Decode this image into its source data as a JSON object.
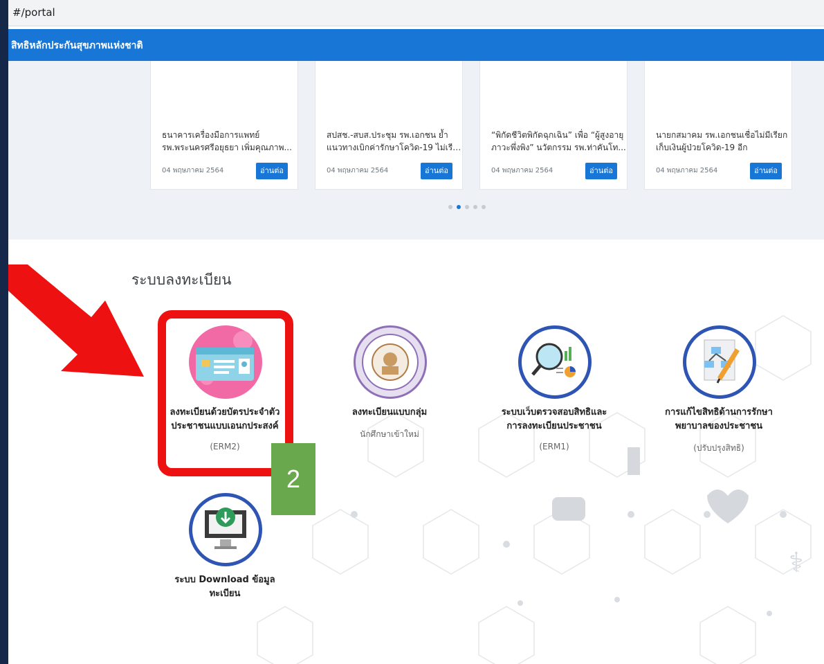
{
  "url": "#/portal",
  "header": {
    "title": "สิทธิหลักประกันสุขภาพแห่งชาติ"
  },
  "news": [
    {
      "line1": "ธนาคารเครื่องมือการแพทย์",
      "line2": "รพ.พระนครศรีอยุธยา เพิ่มคุณภาพ...",
      "date": "04 พฤษภาคม 2564",
      "button": "อ่านต่อ"
    },
    {
      "line1": "สปสช.-สบส.ประชุม รพ.เอกชน ย้ำ",
      "line2": "แนวทางเบิกค่ารักษาโควิด-19 ไม่เรีย...",
      "date": "04 พฤษภาคม 2564",
      "button": "อ่านต่อ"
    },
    {
      "line1": "“พิกัดชีวิตพิกัดฉุกเฉิน” เพื่อ “ผู้สูงอายุ",
      "line2": "ภาวะพึ่งพิง” นวัตกรรม รพ.ท่าคันโท...",
      "date": "04 พฤษภาคม 2564",
      "button": "อ่านต่อ"
    },
    {
      "line1": "นายกสมาคม รพ.เอกชนเชื่อไม่มีเรียก",
      "line2": "เก็บเงินผู้ป่วยโควิด-19 อีก",
      "date": "04 พฤษภาคม 2564",
      "button": "อ่านต่อ"
    }
  ],
  "section_title": "ระบบลงทะเบียน",
  "services": [
    {
      "name1": "ลงทะเบียนด้วยบัตรประจำตัว",
      "name2": "ประชาชนแบบเอนกประสงค์",
      "sub": "(ERM2)"
    },
    {
      "name1": "ลงทะเบียนแบบกลุ่ม",
      "name2": "",
      "sub": "นักศึกษาเข้าใหม่"
    },
    {
      "name1": "ระบบเว็บตรวจสอบสิทธิและ",
      "name2": "การลงทะเบียนประชาชน",
      "sub": "(ERM1)"
    },
    {
      "name1": "การแก้ไขสิทธิด้านการรักษา",
      "name2": "พยาบาลของประชาชน",
      "sub": "(ปรับปรุงสิทธิ)"
    },
    {
      "name1": "ระบบ Download ข้อมูล",
      "name2": "ทะเบียน",
      "sub": ""
    }
  ],
  "annotation": {
    "step_number": "2"
  },
  "colors": {
    "primary": "#1877d6",
    "highlight": "#ee1111",
    "badge": "#69a84d",
    "pink": "#f26aa5",
    "ring": "#2f55b4"
  }
}
